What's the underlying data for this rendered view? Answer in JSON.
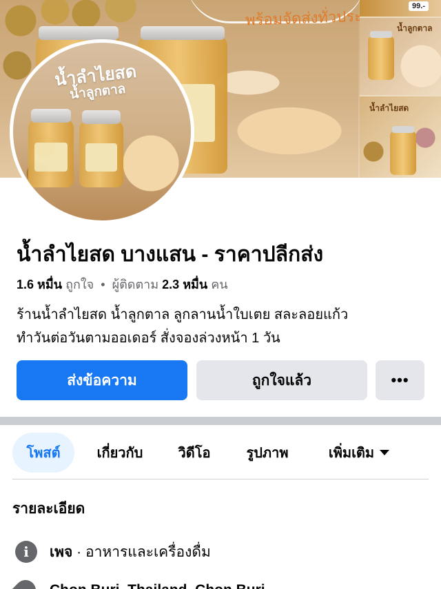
{
  "cover": {
    "tagline": "พร้อมจัดส่งทั่วประเทศ",
    "price_tag": "99.-",
    "thumb2_caption": "น้ำลูกตาล",
    "thumb3_caption": "น้ำลำไยสด"
  },
  "avatar": {
    "title": "น้ำลำไยสด",
    "subtitle": "น้ำลูกตาล"
  },
  "page": {
    "name": "น้ำลำไยสด บางแสน - ราคาปลีกส่ง",
    "likes_count": "1.6 หมื่น",
    "likes_label": "ถูกใจ",
    "separator": "•",
    "followers_label": "ผู้ติดตาม",
    "followers_count": "2.3 หมื่น",
    "followers_unit": "คน",
    "bio_line1": "ร้านน้ำลำไยสด น้ำลูกตาล ลูกลานน้ำใบเตย  สละลอยแก้ว",
    "bio_line2": "ทำวันต่อวันตามออเดอร์ สั่งจองล่วงหน้า 1 วัน"
  },
  "actions": {
    "message": "ส่งข้อความ",
    "liked": "ถูกใจแล้ว",
    "more": "•••"
  },
  "tabs": [
    {
      "label": "โพสต์"
    },
    {
      "label": "เกี่ยวกับ"
    },
    {
      "label": "วิดีโอ"
    },
    {
      "label": "รูปภาพ"
    },
    {
      "label": "เพิ่มเติม"
    }
  ],
  "details": {
    "title": "รายละเอียด",
    "category_prefix": "เพจ",
    "category": "· อาหารและเครื่องดื่ม",
    "location": "Chon Buri, Thailand, Chon Buri"
  },
  "colors": {
    "accent": "#1877f2",
    "button_gray": "#e4e6eb",
    "tab_active_bg": "#e7f3ff"
  }
}
